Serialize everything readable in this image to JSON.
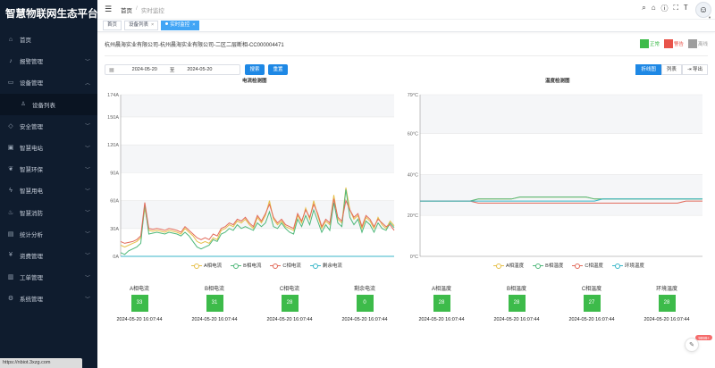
{
  "app": {
    "title": "智慧物联网生态平台"
  },
  "sidebar": {
    "items": [
      {
        "label": "首页",
        "icon": "home-icon"
      },
      {
        "label": "报警管理",
        "icon": "alarm-icon",
        "chevron": true
      },
      {
        "label": "设备管理",
        "icon": "device-icon",
        "chevron": true,
        "expanded": true
      },
      {
        "label": "设备列表",
        "icon": "user-icon",
        "sub": true
      },
      {
        "label": "安全管理",
        "icon": "shield-icon",
        "chevron": true
      },
      {
        "label": "智慧电站",
        "icon": "station-icon",
        "chevron": true
      },
      {
        "label": "智慧环保",
        "icon": "leaf-icon",
        "chevron": true
      },
      {
        "label": "智慧用电",
        "icon": "bolt-icon",
        "chevron": true
      },
      {
        "label": "智慧消防",
        "icon": "fire-icon",
        "chevron": true
      },
      {
        "label": "统计分析",
        "icon": "stats-icon",
        "chevron": true
      },
      {
        "label": "资费管理",
        "icon": "yen-icon",
        "chevron": true
      },
      {
        "label": "工单管理",
        "icon": "ticket-icon",
        "chevron": true
      },
      {
        "label": "系统管理",
        "icon": "gear-icon",
        "chevron": true
      }
    ],
    "status_url": "https://nbiot.3xzg.com"
  },
  "header": {
    "breadcrumb": [
      "首页",
      "实时监控"
    ]
  },
  "tags": [
    {
      "label": "首页",
      "closable": false
    },
    {
      "label": "设备列表",
      "closable": true
    },
    {
      "label": "实时监控",
      "closable": true,
      "active": true
    }
  ],
  "device": {
    "path": "杭州晨海实业有限公司-杭州晨海实业有限公司-二区二层断相-CC000004471",
    "status_legend": [
      {
        "label": "正常",
        "color": "#3dbb4a"
      },
      {
        "label": "警告",
        "color": "#e8534a"
      },
      {
        "label": "离线",
        "color": "#9e9e9e"
      }
    ]
  },
  "filter": {
    "start_date": "2024-05-20",
    "to_label": "至",
    "end_date": "2024-05-20",
    "search_label": "搜索",
    "reset_label": "重置"
  },
  "views": {
    "chart_label": "折线图",
    "list_label": "列表",
    "export_label": "导出"
  },
  "current_gauges": [
    {
      "label": "A相电流",
      "value": "33",
      "time": "2024-05-20 16:07:44"
    },
    {
      "label": "B相电流",
      "value": "31",
      "time": "2024-05-20 16:07:44"
    },
    {
      "label": "C相电流",
      "value": "28",
      "time": "2024-05-20 16:07:44"
    },
    {
      "label": "剩余电流",
      "value": "0",
      "time": "2024-05-20 16:07:44"
    }
  ],
  "temp_gauges": [
    {
      "label": "A相温度",
      "value": "28",
      "time": "2024-05-20 16:07:44"
    },
    {
      "label": "B相温度",
      "value": "28",
      "time": "2024-05-20 16:07:44"
    },
    {
      "label": "C相温度",
      "value": "27",
      "time": "2024-05-20 16:07:44"
    },
    {
      "label": "环境温度",
      "value": "28",
      "time": "2024-05-20 16:07:44"
    }
  ],
  "misc": {
    "badge": "9999+"
  },
  "chart_data": [
    {
      "type": "line",
      "title": "电流检测图",
      "ylim": [
        0,
        174
      ],
      "yticks": [
        "0A",
        "30A",
        "60A",
        "90A",
        "120A",
        "150A",
        "174A"
      ],
      "ytick_values": [
        0,
        30,
        60,
        90,
        120,
        150,
        174
      ],
      "grid": true,
      "legend_position": "bottom",
      "series": [
        {
          "name": "A相电流",
          "color": "#e6c04a",
          "values": [
            12,
            10,
            12,
            14,
            16,
            20,
            52,
            28,
            27,
            28,
            27,
            26,
            28,
            27,
            26,
            24,
            30,
            26,
            22,
            16,
            14,
            16,
            14,
            20,
            18,
            28,
            30,
            34,
            32,
            38,
            36,
            40,
            34,
            30,
            42,
            36,
            44,
            60,
            40,
            34,
            38,
            32,
            30,
            28,
            44,
            36,
            52,
            40,
            60,
            44,
            30,
            38,
            34,
            66,
            40,
            36,
            74,
            50,
            40,
            44,
            30,
            42,
            38,
            30,
            42,
            34,
            30,
            38,
            33
          ]
        },
        {
          "name": "B相电流",
          "color": "#4fb87a",
          "values": [
            4,
            2,
            6,
            8,
            10,
            14,
            56,
            24,
            25,
            26,
            25,
            24,
            26,
            25,
            24,
            22,
            26,
            22,
            16,
            10,
            8,
            10,
            12,
            18,
            16,
            24,
            26,
            30,
            28,
            34,
            30,
            32,
            30,
            28,
            36,
            32,
            36,
            48,
            32,
            30,
            36,
            30,
            26,
            24,
            40,
            32,
            44,
            34,
            50,
            38,
            26,
            34,
            28,
            58,
            36,
            32,
            72,
            42,
            34,
            40,
            26,
            38,
            34,
            26,
            36,
            30,
            28,
            36,
            31
          ]
        },
        {
          "name": "C相电流",
          "color": "#e26a5a",
          "values": [
            16,
            14,
            15,
            16,
            18,
            22,
            58,
            30,
            29,
            30,
            29,
            28,
            30,
            29,
            28,
            26,
            32,
            28,
            24,
            20,
            18,
            20,
            18,
            24,
            22,
            30,
            32,
            36,
            34,
            40,
            38,
            42,
            36,
            32,
            44,
            38,
            46,
            56,
            42,
            36,
            40,
            34,
            32,
            30,
            46,
            38,
            50,
            42,
            56,
            46,
            32,
            40,
            36,
            62,
            42,
            38,
            60,
            50,
            42,
            46,
            32,
            44,
            40,
            32,
            40,
            36,
            32,
            34,
            28
          ]
        },
        {
          "name": "剩余电流",
          "color": "#38b6c8",
          "values": [
            0,
            0,
            0,
            0,
            0,
            0,
            0,
            0,
            0,
            0,
            0,
            0,
            0,
            0,
            0,
            0,
            0,
            0,
            0,
            0,
            0,
            0,
            0,
            0,
            0,
            0,
            0,
            0,
            0,
            0,
            0,
            0,
            0,
            0,
            0,
            0,
            0,
            0,
            0,
            0,
            0,
            0,
            0,
            0,
            0,
            0,
            0,
            0,
            0,
            0,
            0,
            0,
            0,
            0,
            0,
            0,
            0,
            0,
            0,
            0,
            0,
            0,
            0,
            0,
            0,
            0,
            0,
            0,
            0
          ]
        }
      ]
    },
    {
      "type": "line",
      "title": "温度检测图",
      "ylim": [
        0,
        79
      ],
      "yticks": [
        "0°C",
        "20°C",
        "40°C",
        "60°C",
        "79°C"
      ],
      "ytick_values": [
        0,
        20,
        40,
        60,
        79
      ],
      "grid": true,
      "legend_position": "bottom",
      "series": [
        {
          "name": "A相温度",
          "color": "#e6c04a",
          "values": [
            27,
            27,
            27,
            27,
            27,
            27,
            27,
            28,
            28,
            28,
            28,
            28,
            29,
            29,
            29,
            29,
            29,
            29,
            29,
            29,
            29,
            28,
            28,
            28,
            28,
            28,
            28,
            28,
            28,
            28,
            28,
            28,
            28,
            28,
            28
          ]
        },
        {
          "name": "B相温度",
          "color": "#4fb87a",
          "values": [
            27,
            27,
            27,
            27,
            27,
            27,
            27,
            28,
            28,
            28,
            28,
            28,
            29,
            29,
            29,
            29,
            29,
            29,
            29,
            29,
            29,
            28,
            28,
            28,
            28,
            28,
            28,
            28,
            28,
            28,
            28,
            28,
            28,
            28,
            28
          ]
        },
        {
          "name": "C相温度",
          "color": "#e26a5a",
          "values": [
            27,
            27,
            27,
            27,
            27,
            27,
            27,
            26,
            26,
            26,
            26,
            26,
            26,
            26,
            26,
            26,
            26,
            26,
            26,
            26,
            26,
            26,
            26,
            26,
            26,
            26,
            26,
            26,
            26,
            26,
            26,
            26,
            27,
            27,
            27
          ]
        },
        {
          "name": "环境温度",
          "color": "#38b6c8",
          "values": [
            27,
            27,
            27,
            27,
            27,
            27,
            27,
            27,
            27,
            27,
            27,
            27,
            27,
            27,
            27,
            27,
            27,
            27,
            27,
            27,
            27,
            27,
            28,
            28,
            28,
            28,
            28,
            28,
            28,
            28,
            28,
            28,
            28,
            28,
            28
          ]
        }
      ]
    }
  ]
}
